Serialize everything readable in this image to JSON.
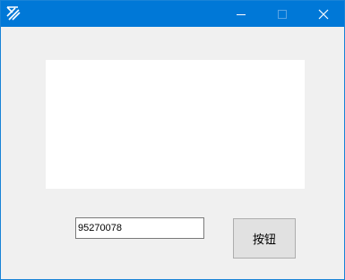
{
  "window": {
    "title": "",
    "icon": "app-icon",
    "titlebar_color": "#0078d7",
    "controls": {
      "minimize": "minimize-icon",
      "maximize": "maximize-icon",
      "close": "close-icon"
    }
  },
  "form": {
    "text_field_value": "95270078",
    "button_label": "按钮"
  }
}
